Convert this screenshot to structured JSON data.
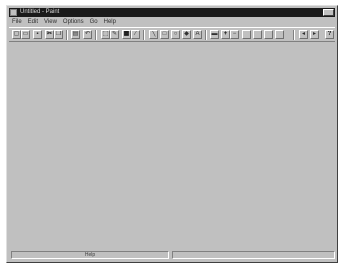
{
  "window": {
    "title": "Untitled - Paint"
  },
  "menu": [
    "File",
    "Edit",
    "View",
    "Options",
    "Go",
    "Help"
  ],
  "toolbar": {
    "buttons": [
      {
        "icon": "new-icon",
        "glyph": "▢"
      },
      {
        "icon": "open-icon",
        "glyph": "▭"
      },
      {
        "icon": "save-icon",
        "glyph": "▪"
      },
      {
        "icon": "cut-icon",
        "glyph": "✂"
      },
      {
        "icon": "copy-icon",
        "glyph": "❐"
      },
      {
        "icon": "paste-icon",
        "glyph": "▤"
      },
      {
        "icon": "undo-icon",
        "glyph": "↶"
      },
      {
        "icon": "grid-icon",
        "glyph": "▦"
      },
      {
        "icon": "select-icon",
        "glyph": "⬚"
      },
      {
        "icon": "pencil-icon",
        "glyph": "✎"
      },
      {
        "icon": "brush-icon",
        "glyph": "∕"
      },
      {
        "icon": "line-icon",
        "glyph": "╲"
      },
      {
        "icon": "rect-icon",
        "glyph": "□"
      },
      {
        "icon": "ellipse-icon",
        "glyph": "○"
      },
      {
        "icon": "fill-icon",
        "glyph": "◆"
      },
      {
        "icon": "text-icon",
        "glyph": "A"
      },
      {
        "icon": "eraser-icon",
        "glyph": "▬"
      },
      {
        "icon": "zoom-in-icon",
        "glyph": "+"
      },
      {
        "icon": "zoom-out-icon",
        "glyph": "−"
      },
      {
        "icon": "prev-icon",
        "glyph": "◂"
      },
      {
        "icon": "next-icon",
        "glyph": "▸"
      },
      {
        "icon": "help-icon",
        "glyph": "?"
      }
    ]
  },
  "status": {
    "left": "Help",
    "right": ""
  }
}
